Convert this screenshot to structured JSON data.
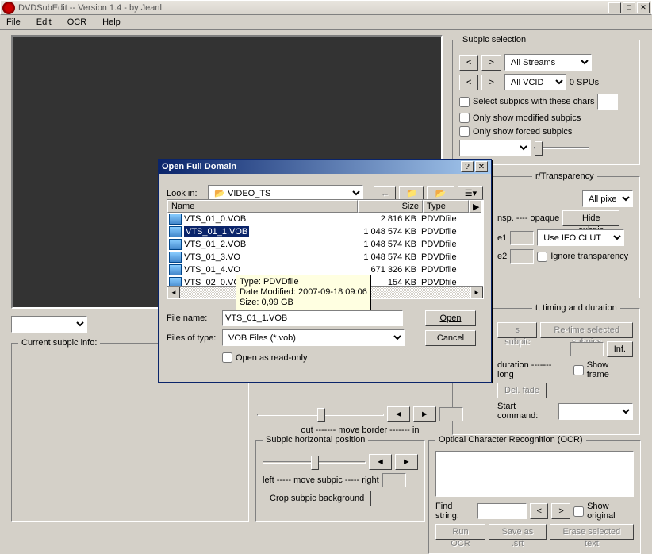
{
  "window": {
    "title": "DVDSubEdit -- Version 1.4 - by Jeanl"
  },
  "menu": {
    "file": "File",
    "edit": "Edit",
    "ocr": "OCR",
    "help": "Help"
  },
  "subpic_selection": {
    "legend": "Subpic selection",
    "stream": "All Streams",
    "vcid": "All VCID",
    "spus": "0 SPUs",
    "cb1": "Select subpics with these chars",
    "cb2": "Only show modified subpics",
    "cb3": "Only show forced subpics"
  },
  "transparency": {
    "legend": "r/Transparency",
    "pixels": "All pixels",
    "hide": "Hide subpic",
    "scale": "nsp. ---- opaque",
    "e1": "e1",
    "e2": "e2",
    "clut": "Use IFO CLUT",
    "ignore": "Ignore transparency"
  },
  "timing": {
    "legend": "t, timing and duration",
    "s_subpic": "s subpic",
    "retime": "Re-time selected subpics",
    "inf": "Inf.",
    "duration": "duration ------- long",
    "showframe": "Show frame",
    "delfade": "Del. fade",
    "startcmd": "Start command:"
  },
  "horiz": {
    "legend": "Subpic horizontal position",
    "scale": "left ----- move subpic ----- right",
    "crop": "Crop subpic background"
  },
  "border": {
    "scale": "out ------- move border ------- in"
  },
  "ocr": {
    "legend": "Optical Character Recognition (OCR)",
    "find": "Find string:",
    "showoriginal": "Show original",
    "run": "Run OCR",
    "saveas": "Save as .srt",
    "erase": "Erase selected text"
  },
  "info": {
    "legend": "Current subpic info:"
  },
  "dialog": {
    "title": "Open Full Domain",
    "lookin_lbl": "Look in:",
    "lookin_val": "VIDEO_TS",
    "cols": {
      "name": "Name",
      "size": "Size",
      "type": "Type"
    },
    "files": [
      {
        "name": "VTS_01_0.VOB",
        "size": "2 816 KB",
        "type": "PDVDfile"
      },
      {
        "name": "VTS_01_1.VOB",
        "size": "1 048 574 KB",
        "type": "PDVDfile",
        "selected": true
      },
      {
        "name": "VTS_01_2.VOB",
        "size": "1 048 574 KB",
        "type": "PDVDfile"
      },
      {
        "name": "VTS_01_3.VO",
        "size": "1 048 574 KB",
        "type": "PDVDfile"
      },
      {
        "name": "VTS_01_4.VO",
        "size": "671 326 KB",
        "type": "PDVDfile"
      },
      {
        "name": "VTS_02_0.VO",
        "size": "154 KB",
        "type": "PDVDfile"
      }
    ],
    "tooltip": {
      "type": "Type: PDVDfile",
      "date": "Date Modified: 2007-09-18 09:06",
      "size": "Size: 0,99 GB"
    },
    "filename_lbl": "File name:",
    "filename_val": "VTS_01_1.VOB",
    "filetype_lbl": "Files of type:",
    "filetype_val": "VOB Files (*.vob)",
    "open_btn": "Open",
    "cancel_btn": "Cancel",
    "readonly": "Open as read-only"
  }
}
